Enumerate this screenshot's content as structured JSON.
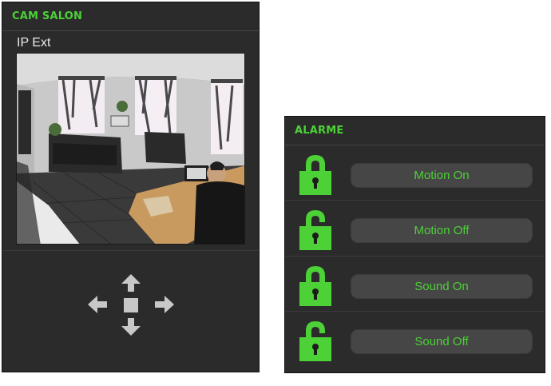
{
  "cam_panel": {
    "title": "CAM SALON",
    "camera_label": "IP Ext",
    "ptz": [
      "arrow-up-icon",
      "arrow-left-icon",
      "stop-icon",
      "arrow-right-icon",
      "arrow-down-icon"
    ]
  },
  "alarm_panel": {
    "title": "ALARME",
    "rows": [
      {
        "label": "Motion On",
        "lock_icon": "lock-closed-icon"
      },
      {
        "label": "Motion Off",
        "lock_icon": "lock-open-icon"
      },
      {
        "label": "Sound On",
        "lock_icon": "lock-closed-icon"
      },
      {
        "label": "Sound Off",
        "lock_icon": "lock-open-icon"
      }
    ]
  },
  "colors": {
    "panel_bg": "#2b2b2b",
    "accent_green": "#4cd137",
    "button_bg": "#464646",
    "ptz_arrow": "#c8c8c8"
  }
}
